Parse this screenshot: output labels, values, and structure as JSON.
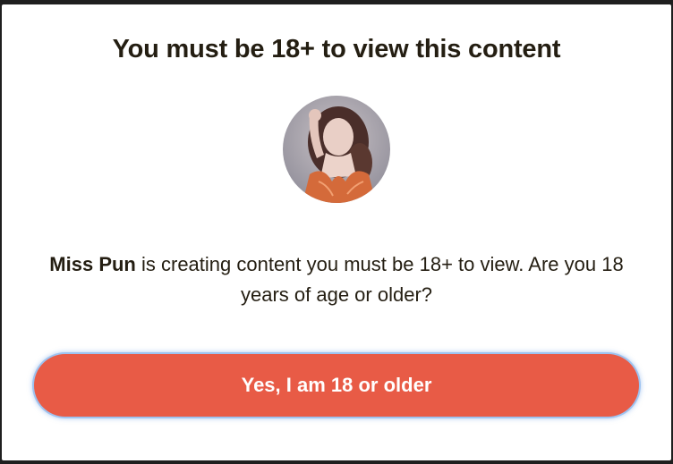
{
  "modal": {
    "title": "You must be 18+ to view this content",
    "creator_name": "Miss Pun",
    "message_rest": " is creating content you must be 18+ to view. Are you 18 years of age or older?",
    "confirm_label": "Yes, I am 18 or older",
    "accent_color": "#e85b46",
    "avatar": {
      "alt": "creator avatar photo"
    }
  }
}
